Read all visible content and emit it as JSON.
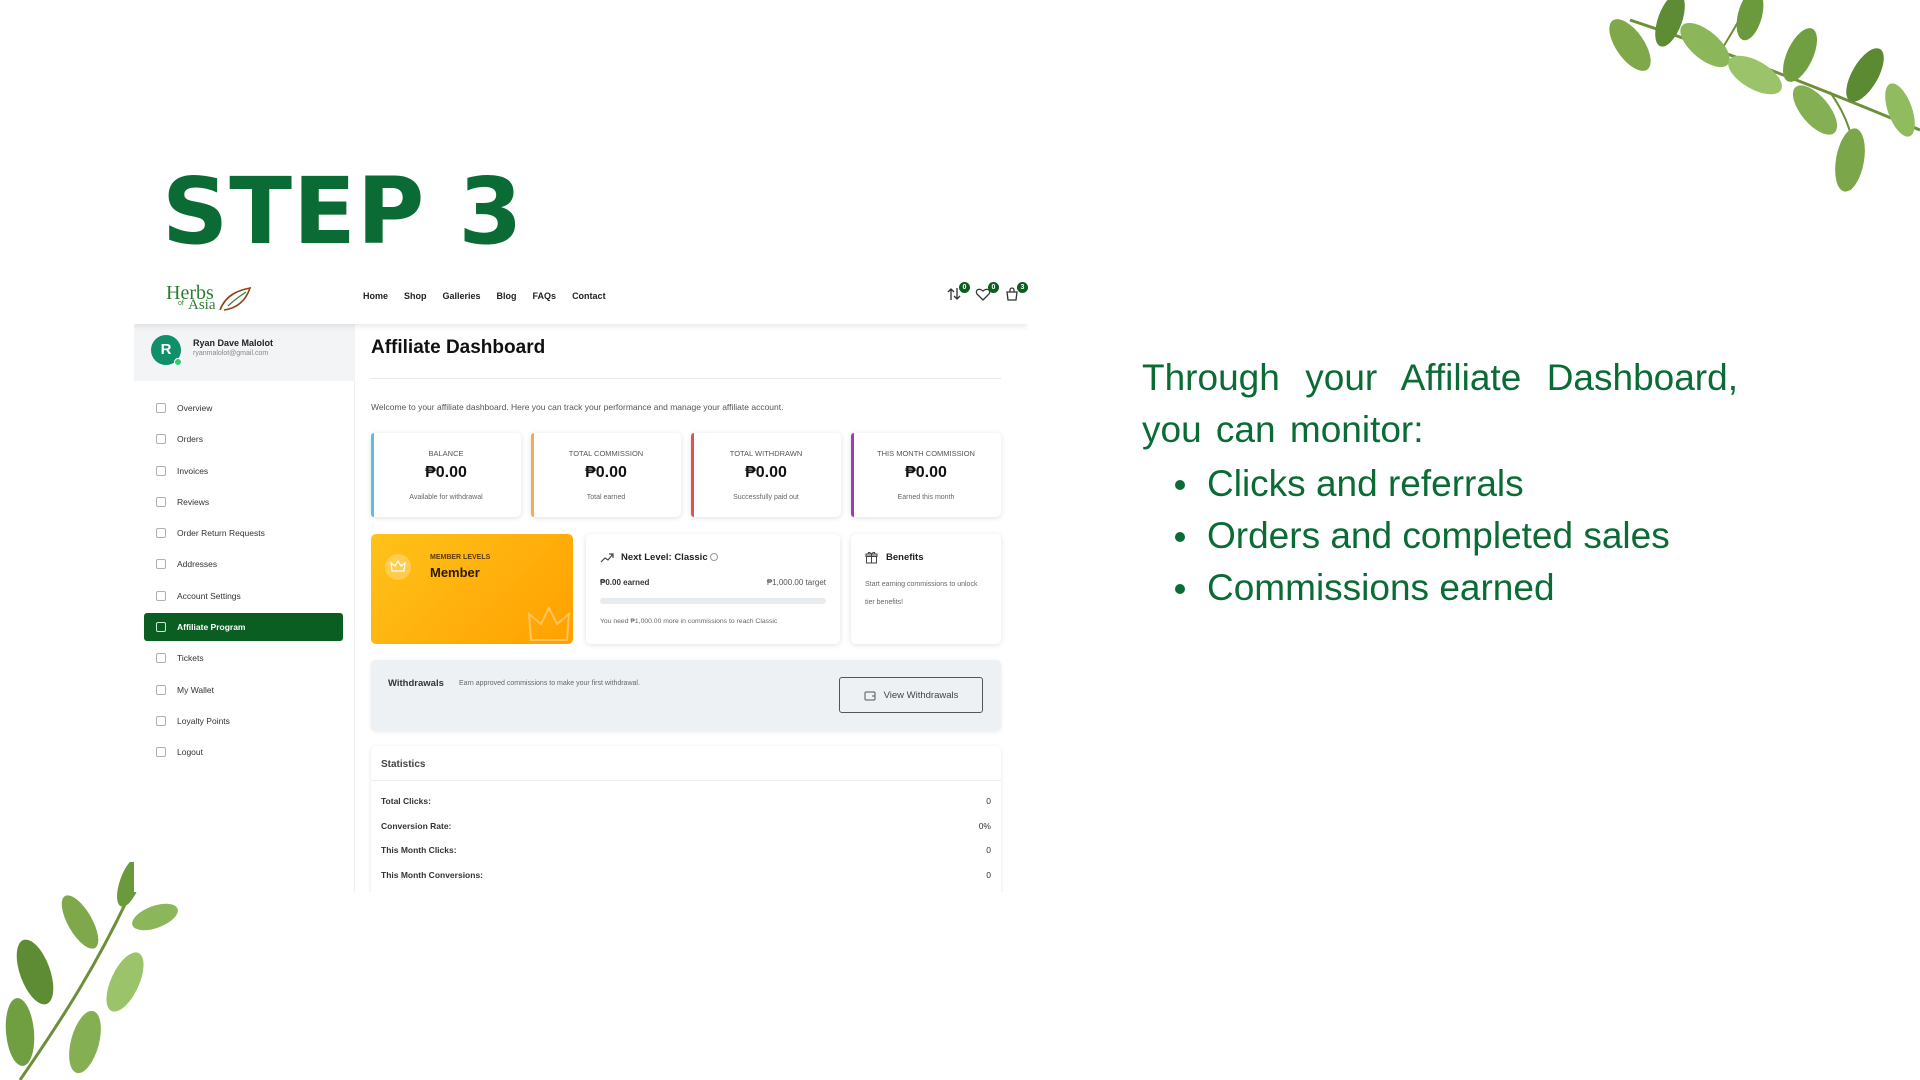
{
  "slide": {
    "step_title": "STEP 3",
    "description": "Through your Affiliate Dashboard, you can monitor:",
    "bullets": [
      "Clicks and referrals",
      "Orders and completed sales",
      "Commissions earned"
    ],
    "accent_color": "#0b6b34",
    "decoration_icons": [
      "leaf-branch-icon",
      "leaf-branch-icon"
    ]
  },
  "site": {
    "logo": {
      "main": "Herbs",
      "of": "of",
      "sub": "Asia"
    },
    "nav": [
      "Home",
      "Shop",
      "Galleries",
      "Blog",
      "FAQs",
      "Contact"
    ],
    "icons": [
      {
        "name": "compare-icon",
        "badge": "0"
      },
      {
        "name": "wishlist-icon",
        "badge": "0"
      },
      {
        "name": "cart-icon",
        "badge": "3"
      }
    ],
    "brand_color": "#0b5e22"
  },
  "profile": {
    "initial": "R",
    "name": "Ryan Dave Malolot",
    "email": "ryanmalolot@gmail.com"
  },
  "menu": [
    {
      "label": "Overview",
      "icon": "home-icon"
    },
    {
      "label": "Orders",
      "icon": "cart-icon"
    },
    {
      "label": "Invoices",
      "icon": "invoice-icon"
    },
    {
      "label": "Reviews",
      "icon": "star-icon"
    },
    {
      "label": "Order Return Requests",
      "icon": "return-icon"
    },
    {
      "label": "Addresses",
      "icon": "address-book-icon"
    },
    {
      "label": "Account Settings",
      "icon": "gear-icon"
    },
    {
      "label": "Affiliate Program",
      "icon": "share-icon",
      "active": true
    },
    {
      "label": "Tickets",
      "icon": "ticket-icon"
    },
    {
      "label": "My Wallet",
      "icon": "wallet-icon"
    },
    {
      "label": "Loyalty Points",
      "icon": "gift-icon"
    },
    {
      "label": "Logout",
      "icon": "logout-icon"
    }
  ],
  "dashboard": {
    "title": "Affiliate Dashboard",
    "welcome": "Welcome to your affiliate dashboard. Here you can track your performance and manage your affiliate account.",
    "cards": [
      {
        "label": "BALANCE",
        "value": "₱0.00",
        "sub": "Available for withdrawal",
        "color": "#5bc0de"
      },
      {
        "label": "TOTAL COMMISSION",
        "value": "₱0.00",
        "sub": "Total earned",
        "color": "#f0ad4e"
      },
      {
        "label": "TOTAL WITHDRAWN",
        "value": "₱0.00",
        "sub": "Successfully paid out",
        "color": "#e05252"
      },
      {
        "label": "THIS MONTH COMMISSION",
        "value": "₱0.00",
        "sub": "Earned this month",
        "color": "#9c3bbf"
      }
    ],
    "member": {
      "label": "MEMBER LEVELS",
      "value": "Member",
      "icon": "crown-icon"
    },
    "next_level": {
      "title": "Next Level: Classic",
      "earned": "₱0.00 earned",
      "target": "₱1,000.00 target",
      "progress": 0,
      "note": "You need ₱1,000.00 more in commissions to reach Classic"
    },
    "benefits": {
      "title": "Benefits",
      "text": "Start earning commissions to unlock tier benefits!"
    },
    "withdrawals": {
      "title": "Withdrawals",
      "text": "Earn approved commissions to make your first withdrawal.",
      "button": "View Withdrawals"
    },
    "statistics": {
      "title": "Statistics",
      "rows": [
        {
          "label": "Total Clicks:",
          "value": "0"
        },
        {
          "label": "Conversion Rate:",
          "value": "0%"
        },
        {
          "label": "This Month Clicks:",
          "value": "0"
        },
        {
          "label": "This Month Conversions:",
          "value": "0"
        }
      ]
    }
  }
}
